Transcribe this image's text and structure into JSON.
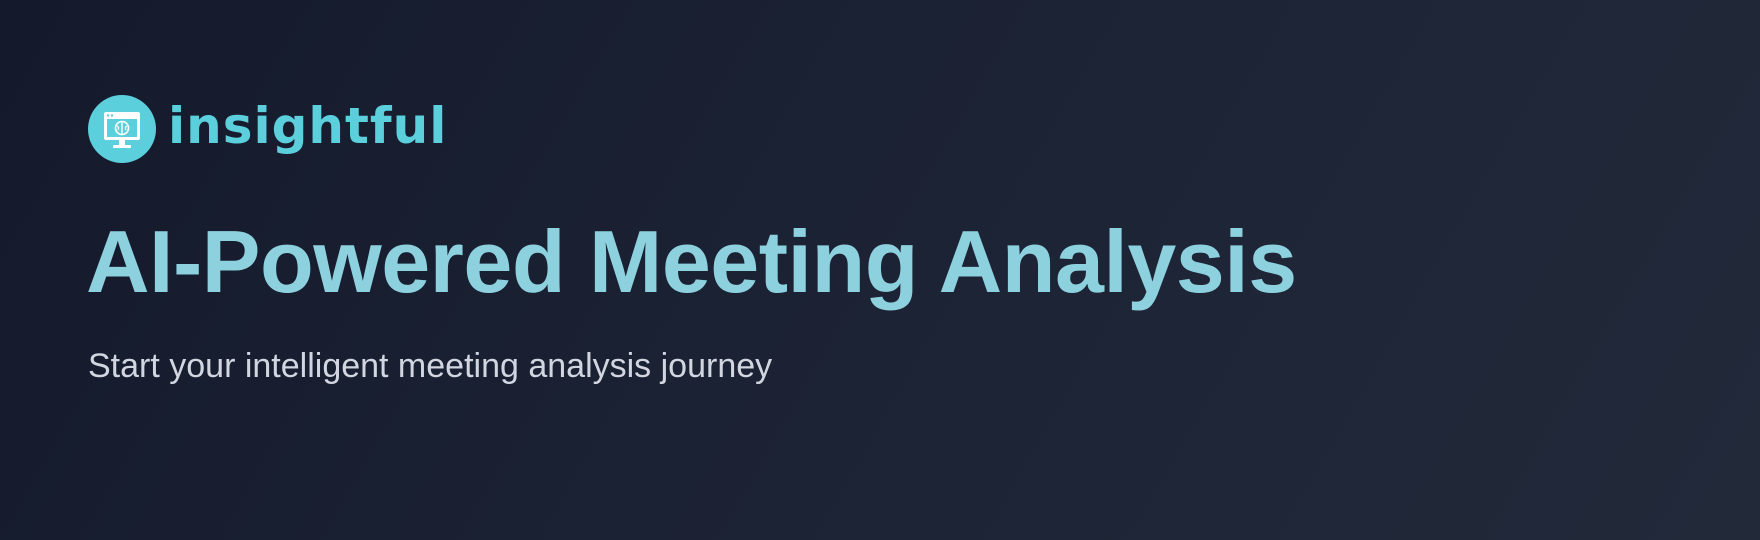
{
  "brand": {
    "name": "insightful",
    "logo_icon": "monitor-brain-icon"
  },
  "hero": {
    "title": "AI-Powered Meeting Analysis",
    "subtitle": "Start your intelligent meeting analysis journey"
  },
  "colors": {
    "background_start": "#141a2c",
    "background_end": "#222a3a",
    "brand_cyan": "#5ccfdc",
    "title_color": "#8dd0de",
    "subtitle_color": "#d2d6e0"
  }
}
